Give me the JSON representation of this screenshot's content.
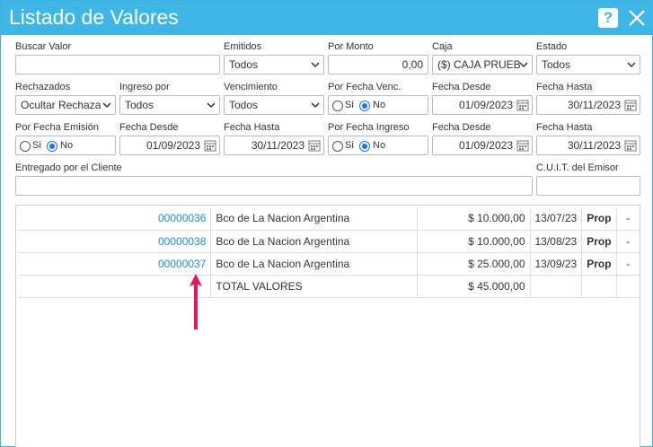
{
  "window": {
    "title": "Listado de Valores",
    "help_icon": "?"
  },
  "filters": {
    "buscar_valor": {
      "label": "Buscar Valor",
      "value": ""
    },
    "emitidos": {
      "label": "Emitidos",
      "value": "Todos"
    },
    "por_monto": {
      "label": "Por Monto",
      "value": "0,00"
    },
    "caja": {
      "label": "Caja",
      "value": "($) CAJA PRUEB"
    },
    "estado": {
      "label": "Estado",
      "value": "Todos"
    },
    "rechazados": {
      "label": "Rechazados",
      "value": "Ocultar Rechaza"
    },
    "ingreso_por": {
      "label": "Ingreso por",
      "value": "Todos"
    },
    "vencimiento": {
      "label": "Vencimiento",
      "value": "Todos"
    },
    "por_fecha_venc": {
      "label": "Por Fecha Venc.",
      "opt_si": "Si",
      "opt_no": "No"
    },
    "fecha_desde_1": {
      "label": "Fecha Desde",
      "value": "01/09/2023"
    },
    "fecha_hasta_1": {
      "label": "Fecha Hasta",
      "value": "30/11/2023"
    },
    "por_fecha_emision": {
      "label": "Por Fecha Emisión",
      "opt_si": "Si",
      "opt_no": "No"
    },
    "fecha_desde_2": {
      "label": "Fecha Desde",
      "value": "01/09/2023"
    },
    "fecha_hasta_2": {
      "label": "Fecha Hasta",
      "value": "30/11/2023"
    },
    "por_fecha_ingreso": {
      "label": "Por Fecha Ingreso",
      "opt_si": "Si",
      "opt_no": "No"
    },
    "fecha_desde_3": {
      "label": "Fecha Desde",
      "value": "01/09/2023"
    },
    "fecha_hasta_3": {
      "label": "Fecha Hasta",
      "value": "30/11/2023"
    },
    "entregado_por": {
      "label": "Entregado por el Cliente",
      "value": ""
    },
    "cuit_emisor": {
      "label": "C.U.I.T. del Emisor",
      "value": ""
    }
  },
  "rows": [
    {
      "numero": "00000036",
      "banco": "Bco de La Nacion Argentina",
      "importe": "$ 10.000,00",
      "fecha": "13/07/23",
      "tipo": "Prop",
      "extra": "-"
    },
    {
      "numero": "00000038",
      "banco": "Bco de La Nacion Argentina",
      "importe": "$ 10.000,00",
      "fecha": "13/08/23",
      "tipo": "Prop",
      "extra": "-"
    },
    {
      "numero": "00000037",
      "banco": "Bco de La Nacion Argentina",
      "importe": "$ 25.000,00",
      "fecha": "13/09/23",
      "tipo": "Prop",
      "extra": "-"
    }
  ],
  "total": {
    "label": "TOTAL VALORES",
    "importe": "$ 45.000,00"
  },
  "colors": {
    "title_bar": "#3fb6e6",
    "link": "#1d8fc7",
    "arrow": "#e8175d"
  }
}
